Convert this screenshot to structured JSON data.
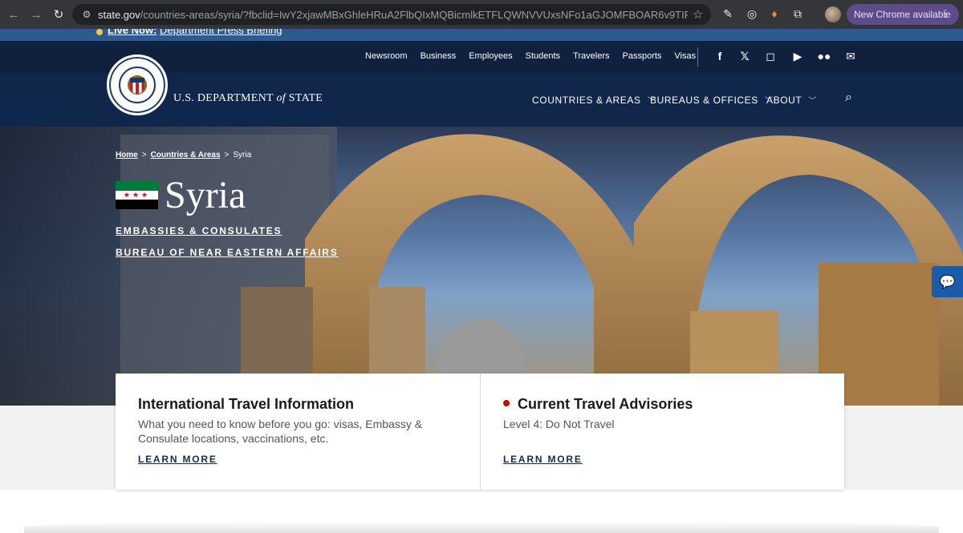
{
  "browser": {
    "url_host": "state.gov",
    "url_path": "/countries-areas/syria/?fbclid=IwY2xjawMBxGhleHRuA2FlbQIxMQBicmlkETFLQWNVVUxsNFo1aGJOMFBOAR6v9TIF-N3q89BNE...",
    "update_label": "New Chrome available"
  },
  "alert": {
    "live_label": "Live Now:",
    "live_text": "Department Press Briefing"
  },
  "utility_nav": [
    "Newsroom",
    "Business",
    "Employees",
    "Students",
    "Travelers",
    "Passports",
    "Visas"
  ],
  "social_icons": [
    "facebook-icon",
    "x-icon",
    "instagram-icon",
    "youtube-icon",
    "flickr-icon",
    "email-icon"
  ],
  "header": {
    "dept_prefix": "U.S. DEPARTMENT",
    "dept_of": "of",
    "dept_suffix": "STATE",
    "menu": [
      "COUNTRIES & AREAS",
      "BUREAUS & OFFICES",
      "ABOUT"
    ]
  },
  "breadcrumb": {
    "home": "Home",
    "sep": ">",
    "section": "Countries & Areas",
    "current": "Syria"
  },
  "hero": {
    "country": "Syria",
    "flag_stars": "★★★",
    "link1": "EMBASSIES & CONSULATES",
    "link2": "BUREAU OF NEAR EASTERN AFFAIRS"
  },
  "cards": [
    {
      "title": "International Travel Information",
      "text": "What you need to know before you go: visas, Embassy & Consulate locations, vaccinations, etc.",
      "link": "LEARN MORE"
    },
    {
      "title": "Current Travel Advisories",
      "text": "Level 4: Do Not Travel",
      "link": "LEARN MORE"
    }
  ],
  "colors": {
    "nav_dark": "#10213f",
    "nav_main": "#10264a",
    "advisory_dot": "#cc0000"
  }
}
